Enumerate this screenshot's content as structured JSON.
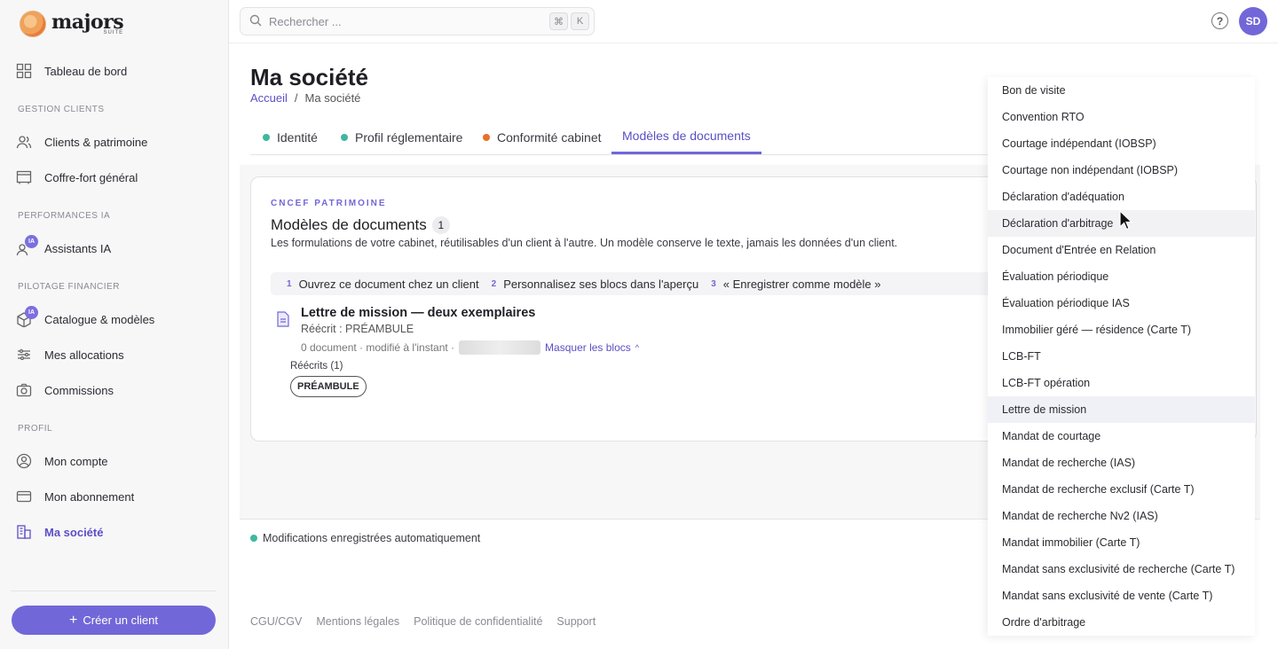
{
  "app": {
    "logo_text": "majors",
    "logo_sub": "SUITE"
  },
  "sidebar": {
    "items": [
      {
        "label": "Tableau de bord"
      },
      {
        "label": "Clients & patrimoine"
      },
      {
        "label": "Coffre-fort général"
      },
      {
        "label": "Assistants IA",
        "badge": "IA"
      },
      {
        "label": "Catalogue & modèles",
        "badge": "IA"
      },
      {
        "label": "Mes allocations"
      },
      {
        "label": "Commissions"
      },
      {
        "label": "Mon compte"
      },
      {
        "label": "Mon abonnement"
      },
      {
        "label": "Ma société"
      }
    ],
    "sections": [
      "GESTION CLIENTS",
      "PERFORMANCES IA",
      "PILOTAGE FINANCIER",
      "PROFIL"
    ],
    "create_button": "Créer un client"
  },
  "search": {
    "placeholder": "Rechercher ...",
    "kbd1": "⌘",
    "kbd2": "K"
  },
  "header": {
    "help": "?",
    "avatar": "SD"
  },
  "page": {
    "title": "Ma société",
    "breadcrumb": {
      "home": "Accueil",
      "sep": "/",
      "current": "Ma société"
    }
  },
  "tabs": [
    {
      "label": "Identité",
      "dot": "#3fb7a0"
    },
    {
      "label": "Profil réglementaire",
      "dot": "#3fb7a0"
    },
    {
      "label": "Conformité cabinet",
      "dot": "#e8702a"
    },
    {
      "label": "Modèles de documents"
    }
  ],
  "card": {
    "kicker": "CNCEF PATRIMOINE",
    "title": "Modèles de documents",
    "count": "1",
    "description": "Les formulations de votre cabinet, réutilisables d'un client à l'autre. Un modèle conserve le texte, jamais les données d'un client.",
    "steps": [
      {
        "num": "1",
        "text": "Ouvrez ce document chez un client"
      },
      {
        "num": "2",
        "text": "Personnalisez ses blocs dans l'aperçu"
      },
      {
        "num": "3",
        "text": "« Enregistrer comme modèle »"
      }
    ],
    "doc": {
      "title": "Lettre de mission — deux exemplaires",
      "subtitle": "Réécrit : PRÉAMBULE",
      "meta": "0 document · modifié à l'instant ·",
      "mask_link": "Masquer les blocs",
      "rewrites_label": "Réécrits (1)",
      "chip": "PRÉAMBULE"
    }
  },
  "autosave": "Modifications enregistrées automatiquement",
  "footer": [
    "CGU/CGV",
    "Mentions légales",
    "Politique de confidentialité",
    "Support"
  ],
  "dropdown": {
    "items": [
      "Bon de visite",
      "Convention RTO",
      "Courtage indépendant (IOBSP)",
      "Courtage non indépendant (IOBSP)",
      "Déclaration d'adéquation",
      "Déclaration d'arbitrage",
      "Document d'Entrée en Relation",
      "Évaluation périodique",
      "Évaluation périodique IAS",
      "Immobilier géré — résidence (Carte T)",
      "LCB-FT",
      "LCB-FT opération",
      "Lettre de mission",
      "Mandat de courtage",
      "Mandat de recherche (IAS)",
      "Mandat de recherche exclusif (Carte T)",
      "Mandat de recherche Nv2 (IAS)",
      "Mandat immobilier (Carte T)",
      "Mandat sans exclusivité de recherche (Carte T)",
      "Mandat sans exclusivité de vente (Carte T)",
      "Ordre d'arbitrage"
    ],
    "hovered": "Déclaration d'arbitrage",
    "selected": "Lettre de mission"
  },
  "colors": {
    "accent": "#7267d8",
    "accent_text": "#5b4fc6",
    "ok": "#3fb7a0",
    "warn": "#e8702a"
  }
}
